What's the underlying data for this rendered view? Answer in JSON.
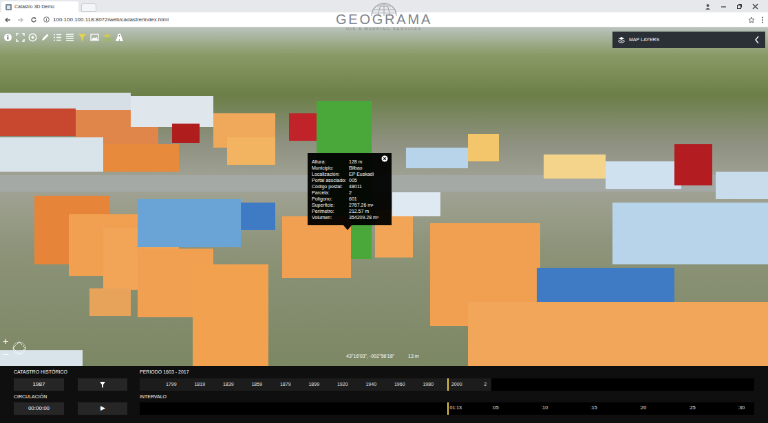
{
  "browser": {
    "tab_title": "Catastro 3D Demo",
    "url": "100.100.100.118:8072/web/cadastre/index.html"
  },
  "logo": {
    "name": "GEOGRAMA",
    "tagline": "GIS & MAPPING SERVICES"
  },
  "map_layers": {
    "label": "MAP LAYERS"
  },
  "tooltip": {
    "rows": [
      {
        "label": "Altura:",
        "value": "128 m"
      },
      {
        "label": "Municipio:",
        "value": "Bilbao"
      },
      {
        "label": "Localización:",
        "value": "EP Euskadi"
      },
      {
        "label": "Portal asociado:",
        "value": "005"
      },
      {
        "label": "Código postal:",
        "value": "48011"
      },
      {
        "label": "Parcela:",
        "value": "2"
      },
      {
        "label": "Polígono:",
        "value": "601"
      },
      {
        "label": "Superficie:",
        "value": "2767.26 m²"
      },
      {
        "label": "Perímetro:",
        "value": "212.57 m"
      },
      {
        "label": "Volumen:",
        "value": "354209.28 m³"
      }
    ]
  },
  "map_status": {
    "coordinates": "43°16'03\", -002°56'18\"",
    "altitude": "13 m"
  },
  "zoom": {
    "in": "+",
    "out": "−"
  },
  "historic": {
    "label": "CATASTRO HISTÓRICO",
    "year": "1987"
  },
  "period": {
    "label": "PERIODO 1603 - 2017",
    "years": [
      "1799",
      "1819",
      "1839",
      "1859",
      "1879",
      "1899",
      "1920",
      "1940",
      "1960",
      "1980",
      "2000",
      "2"
    ],
    "level": 0.5
  },
  "circulation": {
    "label": "CIRCULACIÓN",
    "time": "00:00:00",
    "play": "▶"
  },
  "interval": {
    "label": "INTERVALO",
    "current": "01:13",
    "ticks": [
      ":05",
      ":10",
      ":15",
      ":20",
      ":25",
      ":30"
    ],
    "level": 0.5
  }
}
